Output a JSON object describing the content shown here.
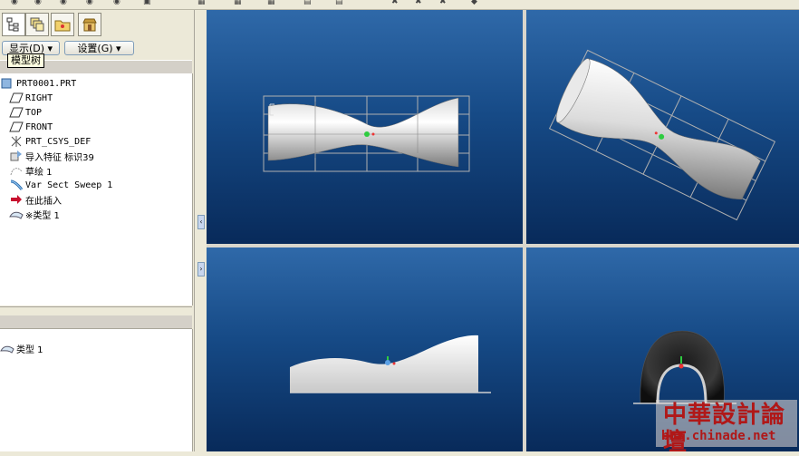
{
  "toolbar": {
    "glyphs": [
      "◉",
      "◉",
      "◉",
      "◉",
      "◉",
      "▣",
      "▦",
      "▦",
      "▦",
      "▤",
      "▤",
      "✖",
      "✖",
      "✖",
      "◆"
    ]
  },
  "panel": {
    "tabs": [
      {
        "icon": "model-tree-icon"
      },
      {
        "icon": "layers-icon"
      },
      {
        "icon": "folder-icon"
      },
      {
        "icon": "favorites-icon"
      }
    ],
    "display_menu": "显示(D) ▾",
    "settings_menu": "设置(G) ▾",
    "tooltip": "模型树"
  },
  "tree": {
    "root": "PRT0001.PRT",
    "items": [
      {
        "label": "RIGHT",
        "icon": "datum-plane-icon"
      },
      {
        "label": "TOP",
        "icon": "datum-plane-icon"
      },
      {
        "label": "FRONT",
        "icon": "datum-plane-icon"
      },
      {
        "label": "PRT_CSYS_DEF",
        "icon": "coordinate-system-icon"
      },
      {
        "label": "导入特征 标识39",
        "icon": "import-feature-icon"
      },
      {
        "label": "草绘 1",
        "icon": "sketch-icon"
      },
      {
        "label": "Var Sect Sweep 1",
        "icon": "sweep-icon"
      },
      {
        "label": "在此插入",
        "icon": "insert-here-arrow-icon"
      },
      {
        "label": "※类型 1",
        "icon": "surface-icon"
      }
    ]
  },
  "lower_panel": {
    "item": "类型 1"
  },
  "watermark": {
    "title": "中華設計論壇",
    "url": "bbs.chinade.net"
  },
  "colors": {
    "viewport_top": "#2f69a9",
    "viewport_bottom": "#082a5a",
    "watermark": "#b01818"
  }
}
